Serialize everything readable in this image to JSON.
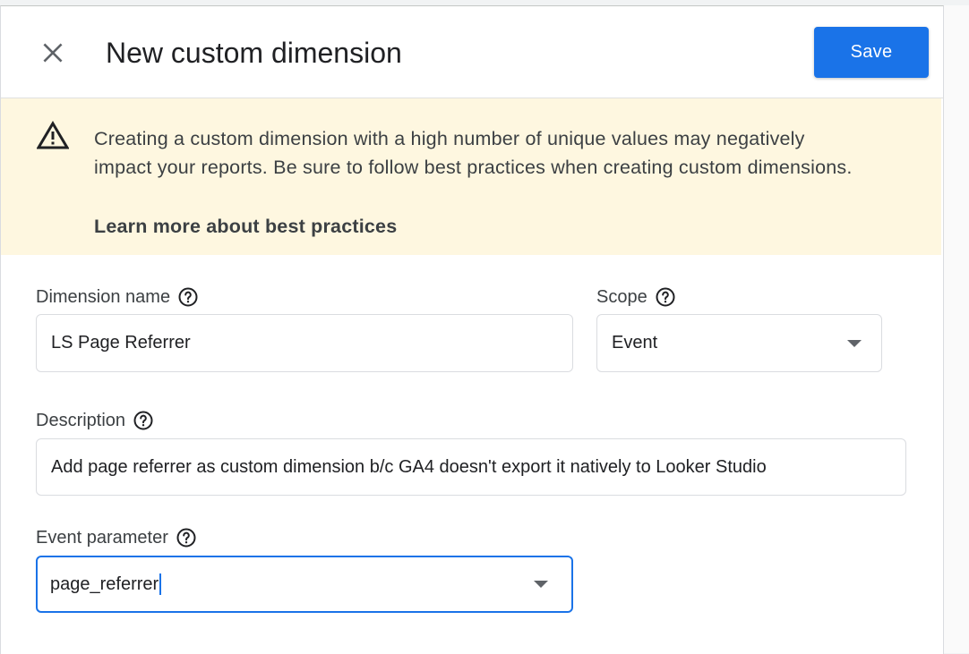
{
  "header": {
    "title": "New custom dimension",
    "save_label": "Save"
  },
  "warning": {
    "line1": "Creating a custom dimension with a high number of unique values may negatively",
    "line2": "impact your reports. Be sure to follow best practices when creating custom dimensions.",
    "link": "Learn more about best practices"
  },
  "form": {
    "dimension_name": {
      "label": "Dimension name",
      "value": "LS Page Referrer"
    },
    "scope": {
      "label": "Scope",
      "value": "Event"
    },
    "description": {
      "label": "Description",
      "value": "Add page referrer as custom dimension b/c GA4 doesn't export it natively to Looker Studio"
    },
    "event_parameter": {
      "label": "Event parameter",
      "value": "page_referrer"
    }
  },
  "icons": {
    "close": "close-icon",
    "warning": "warning-icon",
    "help": "help-icon",
    "dropdown": "chevron-down-icon"
  },
  "colors": {
    "accent": "#1a73e8",
    "warning_bg": "#fef7e0"
  }
}
